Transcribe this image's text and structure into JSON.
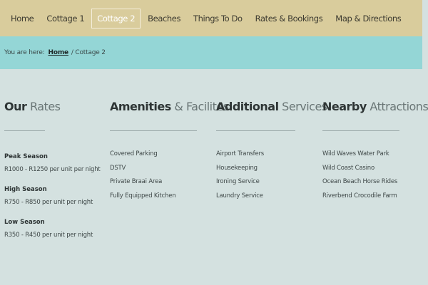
{
  "nav": {
    "items": [
      {
        "label": "Home"
      },
      {
        "label": "Cottage 1"
      },
      {
        "label": "Cottage 2",
        "active": true
      },
      {
        "label": "Beaches"
      },
      {
        "label": "Things To Do"
      },
      {
        "label": "Rates & Bookings"
      },
      {
        "label": "Map & Directions"
      }
    ]
  },
  "breadcrumb": {
    "prefix": "You are here:",
    "home": "Home",
    "current": "/ Cottage 2"
  },
  "rates": {
    "title_bold": "Our",
    "title_light": " Rates",
    "seasons": [
      {
        "name": "Peak Season",
        "price": "R1000 - R1250 per unit per night"
      },
      {
        "name": "High Season",
        "price": "R750 - R850 per unit per night"
      },
      {
        "name": "Low Season",
        "price": "R350 - R450 per unit per night"
      }
    ]
  },
  "amenities": {
    "title_bold": "Amenities",
    "title_light": " & Facilites",
    "items": [
      "Covered Parking",
      "DSTV",
      "Private Braai Area",
      "Fully Equipped Kitchen"
    ]
  },
  "services": {
    "title_bold": "Additional",
    "title_light": " Services",
    "items": [
      "Airport Transfers",
      "Housekeeping",
      "Ironing Service",
      "Laundry Service"
    ]
  },
  "attractions": {
    "title_bold": "Nearby",
    "title_light": " Attractions",
    "items": [
      "Wild Waves Water Park",
      "Wild Coast Casino",
      "Ocean Beach Horse Rides",
      "Riverbend Crocodile Farm"
    ]
  },
  "colors": {
    "nav_bg": "#d9cc9c",
    "breadcrumb_bg": "#94d6d6",
    "page_bg": "#d4e1e0"
  }
}
